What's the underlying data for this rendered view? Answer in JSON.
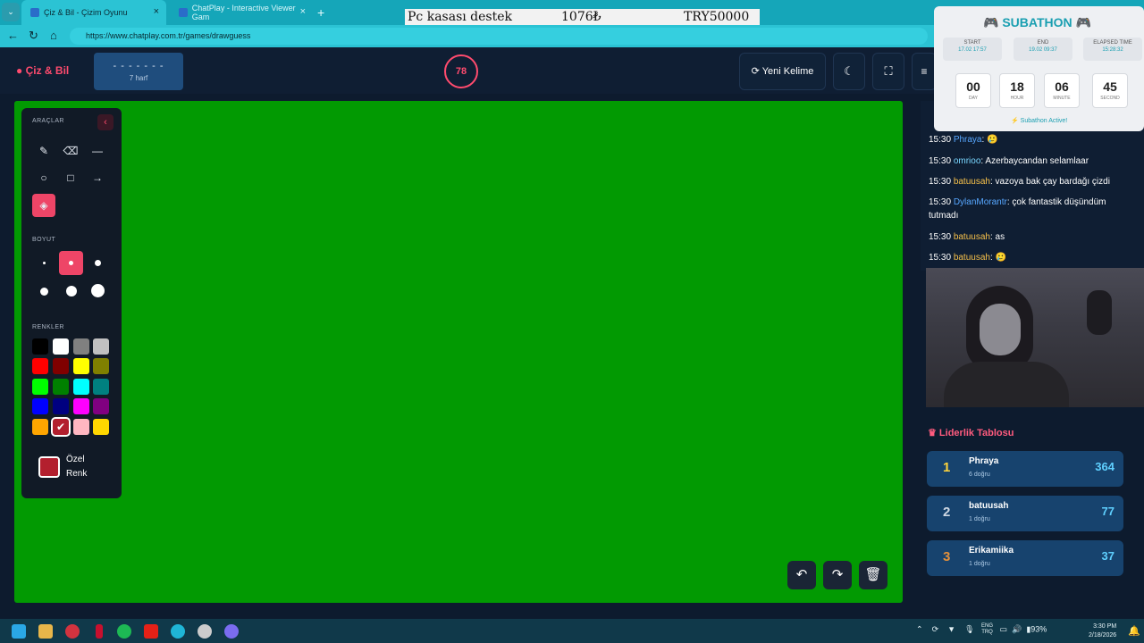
{
  "browser": {
    "tabs": [
      {
        "label": "Çiz & Bil - Çizim Oyunu",
        "active": true
      },
      {
        "label": "ChatPlay - Interactive Viewer Gam",
        "active": false
      }
    ],
    "url": "https://www.chatplay.com.tr/games/drawguess",
    "tab_menu": "⌄",
    "new_tab": "+",
    "close": "×"
  },
  "donation_bar": {
    "text": "Pc kasası destek",
    "amount": "1076₺",
    "goal": "TRY50000"
  },
  "header": {
    "logo": "Çiz & Bil",
    "word_mask": "- - - - - - -",
    "word_length": "7 harf",
    "timer": "78",
    "new_word_button": "Yeni Kelime"
  },
  "tools": {
    "title": "ARAÇLAR",
    "size_label": "BOYUT",
    "colors_label": "RENKLER",
    "custom_color_line1": "Özel",
    "custom_color_line2": "Renk",
    "palette": [
      "#000000",
      "#ffffff",
      "#808080",
      "#c0c0c0",
      "#ff0000",
      "#800000",
      "#ffff00",
      "#808000",
      "#00ff00",
      "#008000",
      "#00ffff",
      "#008080",
      "#0000ff",
      "#000080",
      "#ff00ff",
      "#800080",
      "#ffa500",
      "#b31f2e",
      "#ffb6c1",
      "#ffd700"
    ],
    "selected_color": "#b31f2e",
    "canvas_color": "#029a02"
  },
  "chat": [
    {
      "time": "15:30",
      "user": "Phraya",
      "user_color": "#57a7ff",
      "msg": "🥲"
    },
    {
      "time": "15:30",
      "user": "omrioo",
      "user_color": "#7ad7ff",
      "msg": "Azerbaycandan selamlaar"
    },
    {
      "time": "15:30",
      "user": "batuusah",
      "user_color": "#f6c04a",
      "msg": "vazoya bak çay bardağı çizdi"
    },
    {
      "time": "15:30",
      "user": "DylanMorantr",
      "user_color": "#57a7ff",
      "msg": "çok fantastik düşündüm tutmadı"
    },
    {
      "time": "15:30",
      "user": "batuusah",
      "user_color": "#f6c04a",
      "msg": "as"
    },
    {
      "time": "15:30",
      "user": "batuusah",
      "user_color": "#f6c04a",
      "msg": "🥲"
    }
  ],
  "leaderboard": {
    "title": "Liderlik Tablosu",
    "rows": [
      {
        "rank": "1",
        "name": "Phraya",
        "correct": "6 doğru",
        "score": "364",
        "rank_color": "#ffd43b"
      },
      {
        "rank": "2",
        "name": "batuusah",
        "correct": "1 doğru",
        "score": "77",
        "rank_color": "#cfd8e3"
      },
      {
        "rank": "3",
        "name": "Erikamiika",
        "correct": "1 doğru",
        "score": "37",
        "rank_color": "#e3903b"
      }
    ]
  },
  "subathon": {
    "title": "SUBATHON",
    "start_label": "START",
    "start": "17.02 17:57",
    "end_label": "END",
    "end": "19.02 09:37",
    "elapsed_label": "ELAPSED TIME",
    "elapsed": "15:28:32",
    "countdown": [
      {
        "n": "00",
        "u": "DAY"
      },
      {
        "n": "18",
        "u": "HOUR"
      },
      {
        "n": "06",
        "u": "MINUTE"
      },
      {
        "n": "45",
        "u": "SECOND"
      }
    ],
    "status": "Subathon Active!"
  },
  "taskbar": {
    "lang1": "ENG",
    "lang2": "TRQ",
    "battery": "93%",
    "time": "3:30 PM",
    "date": "2/18/2026"
  }
}
